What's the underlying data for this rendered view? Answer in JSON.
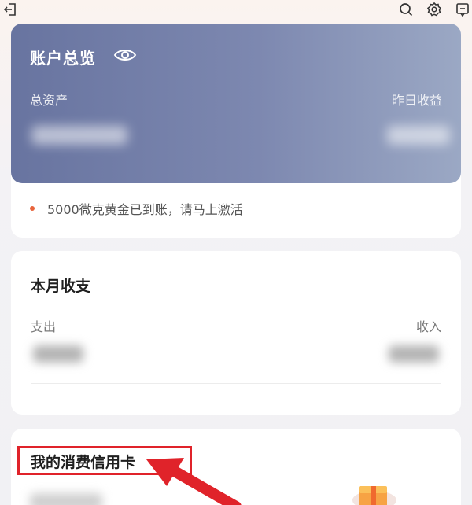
{
  "account": {
    "title": "账户总览",
    "total_assets_label": "总资产",
    "yesterday_income_label": "昨日收益",
    "notice": "5000微克黄金已到账，请马上激活"
  },
  "monthly": {
    "title": "本月收支",
    "expense_label": "支出",
    "income_label": "收入"
  },
  "credit": {
    "title": "我的消费信用卡"
  },
  "colors": {
    "account_header": "#7380aa",
    "highlight": "#e0232a",
    "notice_dot": "#e8643c"
  },
  "icons": [
    "back-icon",
    "search-icon",
    "gear-icon",
    "message-icon",
    "eye-icon",
    "gift-icon",
    "arrow-annotation"
  ]
}
